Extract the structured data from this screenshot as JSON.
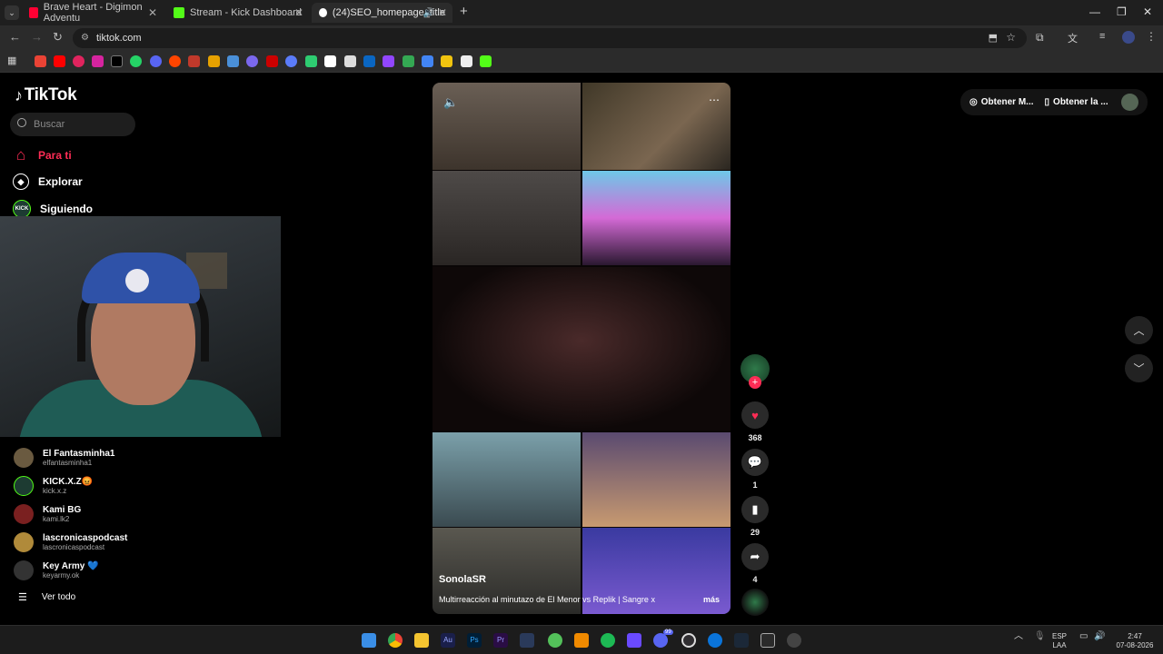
{
  "browser": {
    "tabs": [
      {
        "title": "Brave Heart - Digimon Adventu",
        "color": "#ff0033"
      },
      {
        "title": "Stream - Kick Dashboard",
        "color": "#53fc18"
      },
      {
        "title": "(24)SEO_homepage_title",
        "color": "#ffffff"
      }
    ],
    "new_tab": "+",
    "url": "tiktok.com"
  },
  "sidebar": {
    "brand": "TikTok",
    "search_placeholder": "Buscar",
    "nav": [
      {
        "label": "Para ti",
        "icon": "home-icon",
        "glyph": "⌂",
        "active": true
      },
      {
        "label": "Explorar",
        "icon": "compass-icon",
        "glyph": "◎",
        "active": false
      },
      {
        "label": "Siguiendo",
        "icon": "kick-avatar",
        "glyph": "K",
        "active": false
      }
    ],
    "following": [
      {
        "name": "El Fantasminha1",
        "handle": "elfantasminha1",
        "color": "#6a5a40"
      },
      {
        "name": "KICK.X.Z😡",
        "handle": "kick.x.z",
        "color": "#1d3b32"
      },
      {
        "name": "Kami BG",
        "handle": "kami.lk2",
        "color": "#7a2020"
      },
      {
        "name": "lascronicaspodcast",
        "handle": "lascronicaspodcast",
        "color": "#b08a3a"
      },
      {
        "name": "Key Army 💙",
        "handle": "keyarmy.ok",
        "color": "#333333"
      }
    ],
    "see_all": "Ver todo"
  },
  "video": {
    "author": "SonolaSR",
    "caption": "Multirreacción al minutazo de El Menor vs Replik | Sangre x",
    "more": "más"
  },
  "actions": {
    "likes": "368",
    "comments": "1",
    "saves": "29",
    "shares": "4"
  },
  "topright": {
    "get_coins": "Obtener M...",
    "get_app": "Obtener la ..."
  },
  "taskbar": {
    "lang_top": "ESP",
    "lang_bottom": "LAA",
    "time": "2:47",
    "date": "07-08-2026",
    "badge": "99"
  }
}
